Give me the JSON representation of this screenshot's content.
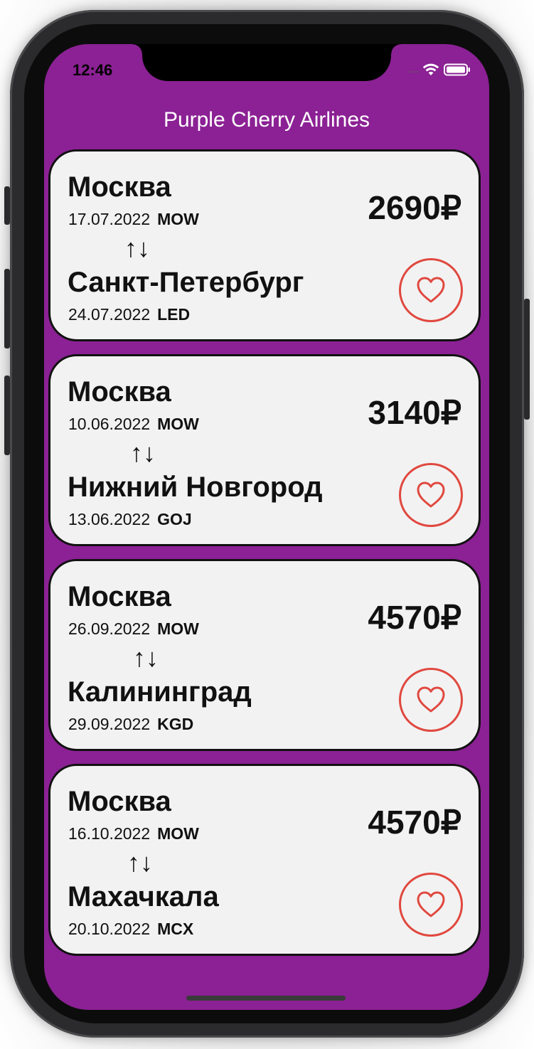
{
  "status_bar": {
    "time": "12:46",
    "signal": "....",
    "wifi_icon": "wifi-icon",
    "battery_icon": "battery-icon"
  },
  "header": {
    "title": "Purple Cherry Airlines"
  },
  "colors": {
    "background": "#8b2194",
    "card": "#f2f2f2",
    "heart": "#e0483f"
  },
  "flights": [
    {
      "from_city": "Москва",
      "from_date": "17.07.2022",
      "from_code": "MOW",
      "swap_icon": "↑↓",
      "to_city": "Санкт-Петербург",
      "to_date": "24.07.2022",
      "to_code": "LED",
      "price": "2690₽",
      "favorite_icon": "heart-icon"
    },
    {
      "from_city": "Москва",
      "from_date": "10.06.2022",
      "from_code": "MOW",
      "swap_icon": "↑↓",
      "to_city": "Нижний Новгород",
      "to_date": "13.06.2022",
      "to_code": "GOJ",
      "price": "3140₽",
      "favorite_icon": "heart-icon"
    },
    {
      "from_city": "Москва",
      "from_date": "26.09.2022",
      "from_code": "MOW",
      "swap_icon": "↑↓",
      "to_city": "Калининград",
      "to_date": "29.09.2022",
      "to_code": "KGD",
      "price": "4570₽",
      "favorite_icon": "heart-icon"
    },
    {
      "from_city": "Москва",
      "from_date": "16.10.2022",
      "from_code": "MOW",
      "swap_icon": "↑↓",
      "to_city": "Махачкала",
      "to_date": "20.10.2022",
      "to_code": "MCX",
      "price": "4570₽",
      "favorite_icon": "heart-icon"
    }
  ]
}
